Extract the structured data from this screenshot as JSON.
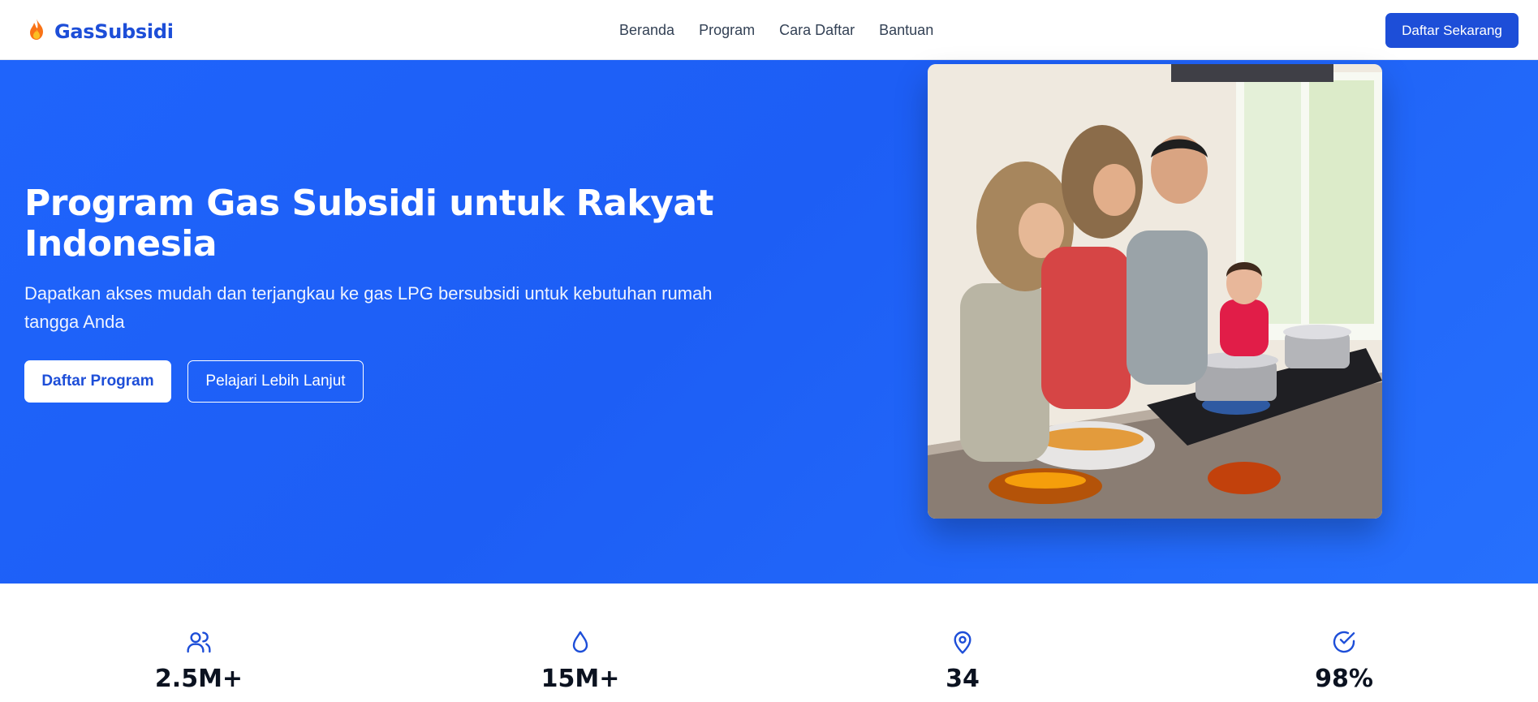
{
  "brand": {
    "name": "GasSubsidi",
    "icon": "flame-icon"
  },
  "nav": {
    "links": [
      "Beranda",
      "Program",
      "Cara Daftar",
      "Bantuan"
    ],
    "cta_label": "Daftar Sekarang"
  },
  "hero": {
    "title": "Program Gas Subsidi untuk Rakyat Indonesia",
    "subtitle": "Dapatkan akses mudah dan terjangkau ke gas LPG bersubsidi untuk kebutuhan rumah tangga Anda",
    "primary_button": "Daftar Program",
    "secondary_button": "Pelajari Lebih Lanjut"
  },
  "stats": [
    {
      "icon": "users-icon",
      "value": "2.5M+"
    },
    {
      "icon": "droplet-icon",
      "value": "15M+"
    },
    {
      "icon": "map-pin-icon",
      "value": "34"
    },
    {
      "icon": "check-circle-icon",
      "value": "98%"
    }
  ],
  "colors": {
    "brand_blue": "#1d4ed8",
    "hero_blue": "#1f64fb",
    "flame": "#f97316"
  }
}
